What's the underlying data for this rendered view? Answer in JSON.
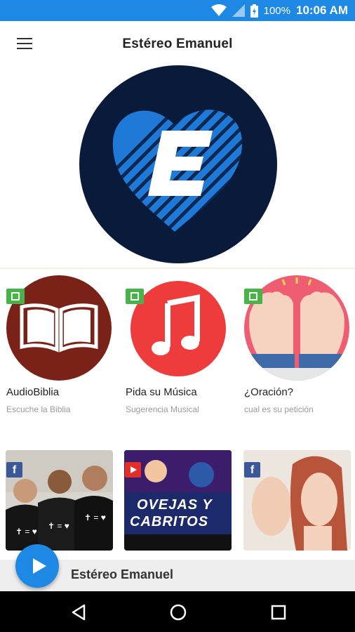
{
  "status": {
    "battery": "100%",
    "time": "10:06 AM"
  },
  "app": {
    "title": "Estéreo Emanuel"
  },
  "cards": [
    {
      "title": "AudioBiblia",
      "subtitle": "Escuche la Biblia"
    },
    {
      "title": "Pida su Música",
      "subtitle": "Sugerencia Musical"
    },
    {
      "title": "¿Oración?",
      "subtitle": "cual es su petición"
    }
  ],
  "videos": [
    {
      "source": "facebook",
      "badge": "f"
    },
    {
      "source": "youtube",
      "badge": "",
      "line1": "OVEJAS Y",
      "line2": "CABRITOS"
    },
    {
      "source": "facebook",
      "badge": "f"
    }
  ],
  "player": {
    "title": "Estéreo Emanuel"
  },
  "colors": {
    "accent": "#1e88e5",
    "logo_bg": "#0a1a3a",
    "bible_bg": "#7a2217",
    "music_bg": "#ee3b3b",
    "prayer_bg": "#ee5d72"
  }
}
